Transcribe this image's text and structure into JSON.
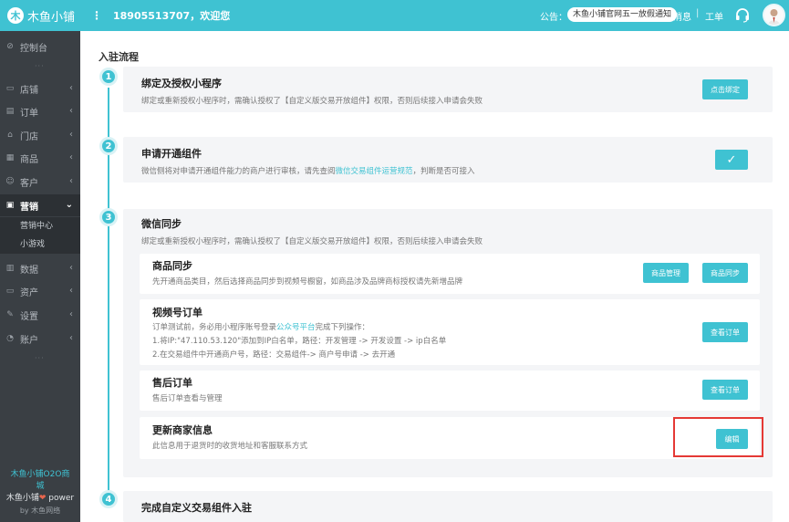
{
  "topbar": {
    "logo_mark": "木",
    "app_name": "木鱼小铺",
    "menu_glyph": "⋮",
    "welcome": "18905513707，欢迎您",
    "notice_label": "公告：",
    "notice_text": "木鱼小铺官网五一放假通知",
    "messages": "消息",
    "separator": "|",
    "ticket": "工单",
    "icons": [
      "headset-icon",
      "avatar"
    ]
  },
  "sidebar": {
    "dashboard": "控制台",
    "items": [
      {
        "label": "店铺",
        "icon": "store-icon"
      },
      {
        "label": "订单",
        "icon": "order-icon"
      },
      {
        "label": "门店",
        "icon": "branch-icon"
      },
      {
        "label": "商品",
        "icon": "goods-icon"
      },
      {
        "label": "客户",
        "icon": "customer-icon"
      },
      {
        "label": "营销",
        "icon": "marketing-icon"
      },
      {
        "label": "数据",
        "icon": "data-icon"
      },
      {
        "label": "资产",
        "icon": "assets-icon"
      },
      {
        "label": "设置",
        "icon": "settings-icon"
      },
      {
        "label": "账户",
        "icon": "account-icon"
      }
    ],
    "sub_items": [
      "营销中心",
      "小游戏"
    ],
    "dots": "···",
    "footer": {
      "brand_line1": "木鱼小铺O2O商",
      "brand_line2": "城",
      "power_prefix": "木鱼小铺",
      "heart": "❤",
      "power_suffix": " power",
      "by": "by 木鱼网络"
    }
  },
  "main": {
    "page_title": "入驻流程",
    "steps": [
      {
        "number": "1",
        "title": "绑定及授权小程序",
        "desc": "绑定或重新授权小程序时，需确认授权了【自定义版交易开放组件】权限，否则后续接入申请会失败",
        "button": "点击绑定"
      },
      {
        "number": "2",
        "title": "申请开通组件",
        "desc_prefix": "微信侧将对申请开通组件能力的商户进行审核，请先查阅",
        "desc_link": "微信交易组件运营规范",
        "desc_suffix": "，判断是否可接入",
        "button": "✓"
      },
      {
        "number": "3",
        "title": "微信同步",
        "desc": "绑定或重新授权小程序时，需确认授权了【自定义版交易开放组件】权限，否则后续接入申请会失败",
        "subsections": [
          {
            "title": "商品同步",
            "desc": "先开通商品类目，然后选择商品同步到视频号橱窗，如商品涉及品牌商标授权请先新增品牌",
            "buttons": [
              "商品管理",
              "商品同步"
            ]
          },
          {
            "title": "视频号订单",
            "desc_line1_prefix": "订单测试前，务必用小程序账号登录",
            "desc_line1_link": "公众号平台",
            "desc_line1_suffix": "完成下列操作：",
            "desc_line2": "1.将IP:\"47.110.53.120\"添加到IP白名单，路径：开发管理 -> 开发设置 -> ip白名单",
            "desc_line3": "2.在交易组件中开通商户号，路径：交易组件-> 商户号申请 -> 去开通",
            "button": "查看订单"
          },
          {
            "title": "售后订单",
            "desc": "售后订单查看与管理",
            "button": "查看订单"
          },
          {
            "title": "更新商家信息",
            "desc": "此信息用于退货时的收货地址和客服联系方式",
            "button": "编辑"
          }
        ]
      },
      {
        "number": "4",
        "title": "完成自定义交易组件入驻"
      }
    ]
  },
  "colors": {
    "accent": "#3fc2d2",
    "sidebar_bg": "#3a3f44",
    "highlight": "#e53935"
  }
}
